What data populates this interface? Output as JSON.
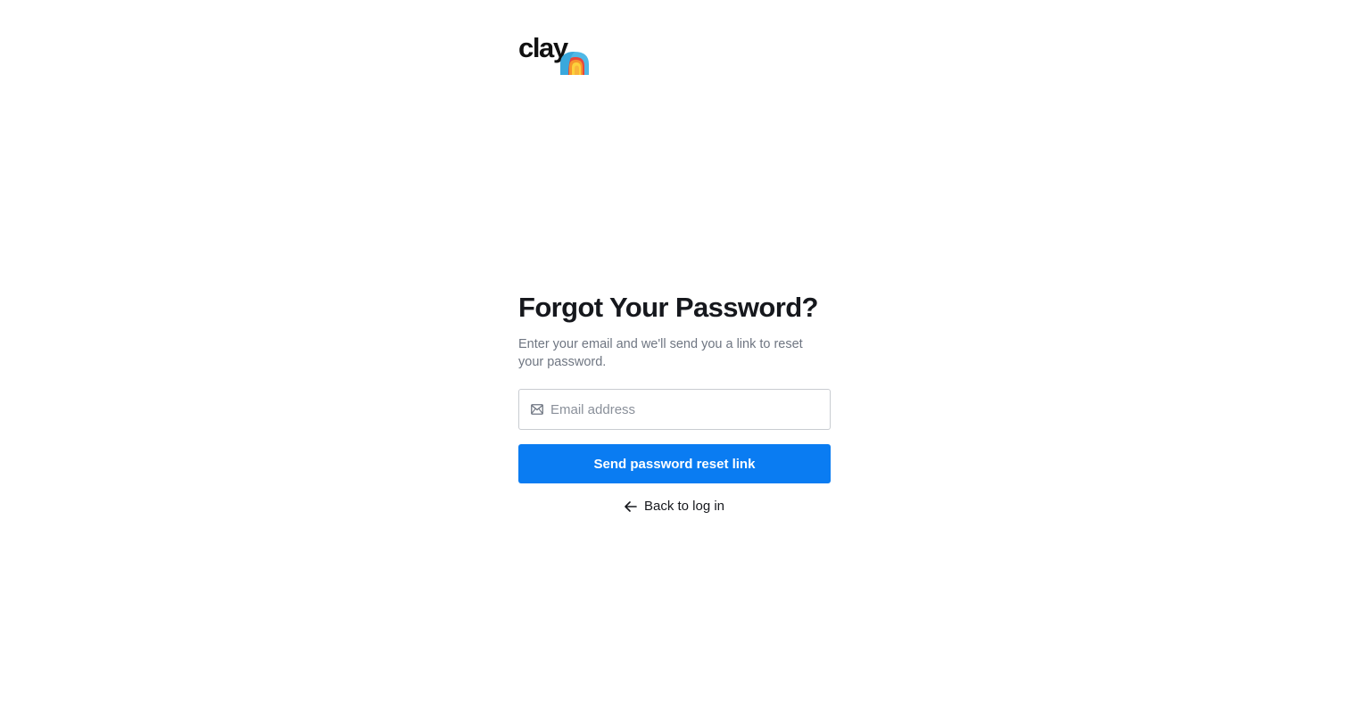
{
  "brand": {
    "name": "clay",
    "accent_color": "#0a7cf2",
    "icon": "rainbow-tent-icon"
  },
  "form": {
    "title": "Forgot Your Password?",
    "subtitle": "Enter your email and we'll send you a link to reset your password.",
    "email_placeholder": "Email address",
    "email_value": "",
    "email_icon": "mail-icon",
    "submit_label": "Send password reset link",
    "back_label": "Back to log in",
    "back_icon": "arrow-left-icon"
  }
}
